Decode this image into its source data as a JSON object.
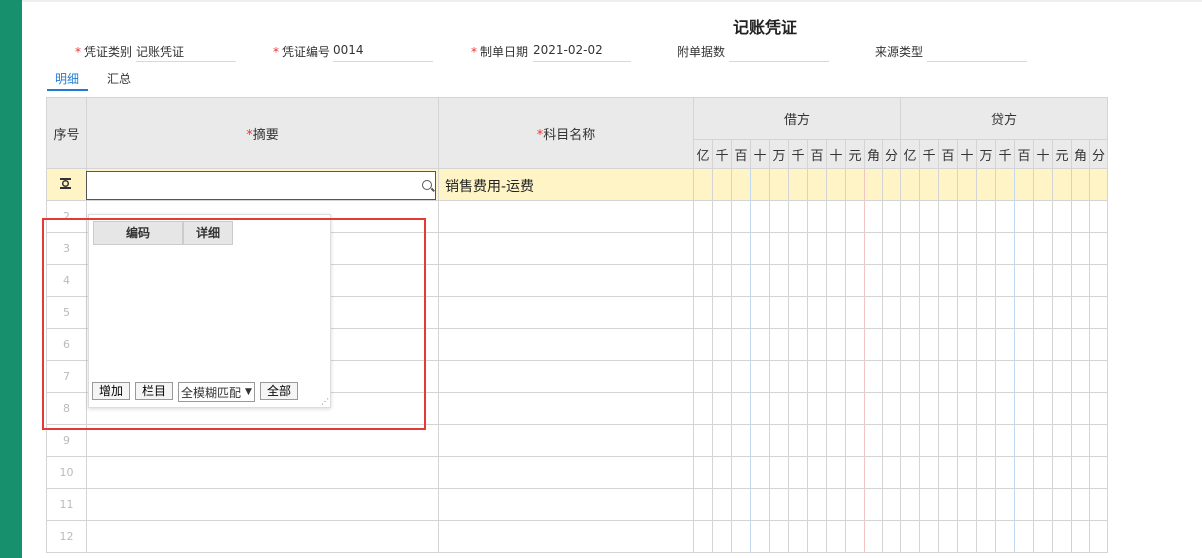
{
  "title": "记账凭证",
  "fields": [
    {
      "label": "凭证类别",
      "required": true,
      "value": ""
    },
    {
      "label": "记账凭证",
      "required": false,
      "value": "记账凭证"
    },
    {
      "label": "凭证编号",
      "required": true,
      "value": "0014"
    },
    {
      "label": "制单日期",
      "required": true,
      "value": "2021-02-02"
    },
    {
      "label": "附单据数",
      "required": false,
      "value": ""
    },
    {
      "label": "来源类型",
      "required": false,
      "value": ""
    }
  ],
  "header": {
    "voucher_type_label": "凭证类别",
    "voucher_type_value": "记账凭证",
    "voucher_no_label": "凭证编号",
    "voucher_no_value": "0014",
    "date_label": "制单日期",
    "date_value": "2021-02-02",
    "attach_label": "附单据数",
    "source_label": "来源类型",
    "required_mark": "*"
  },
  "tabs": [
    {
      "label": "明细",
      "active": true
    },
    {
      "label": "汇总",
      "active": false
    }
  ],
  "table": {
    "col_seq": "序号",
    "col_summary": "摘要",
    "col_subject": "科目名称",
    "col_debit": "借方",
    "col_credit": "贷方",
    "digits": [
      "亿",
      "千",
      "百",
      "十",
      "万",
      "千",
      "百",
      "十",
      "元",
      "角",
      "分"
    ],
    "rows": [
      {
        "num": "",
        "subject": "销售费用-运费"
      },
      {
        "num": "2",
        "subject": ""
      },
      {
        "num": "3",
        "subject": ""
      },
      {
        "num": "4",
        "subject": ""
      },
      {
        "num": "5",
        "subject": ""
      },
      {
        "num": "6",
        "subject": ""
      },
      {
        "num": "7",
        "subject": ""
      },
      {
        "num": "8",
        "subject": ""
      },
      {
        "num": "9",
        "subject": ""
      },
      {
        "num": "10",
        "subject": ""
      },
      {
        "num": "11",
        "subject": ""
      },
      {
        "num": "12",
        "subject": ""
      }
    ]
  },
  "popup": {
    "col_code": "编码",
    "col_detail": "详细",
    "btn_add": "增加",
    "btn_columns": "栏目",
    "match_mode": "全模糊匹配",
    "btn_all": "全部"
  },
  "icons": {
    "row_settings": "gear-icon",
    "search": "search-icon",
    "dropdown": "chevron-down-icon",
    "resize": "resize-grip-icon"
  },
  "colors": {
    "sidebar": "#17906d",
    "active_tab": "#1f7bd4",
    "active_row": "#fff4c6",
    "required": "#e33333",
    "highlight": "#e53935"
  }
}
